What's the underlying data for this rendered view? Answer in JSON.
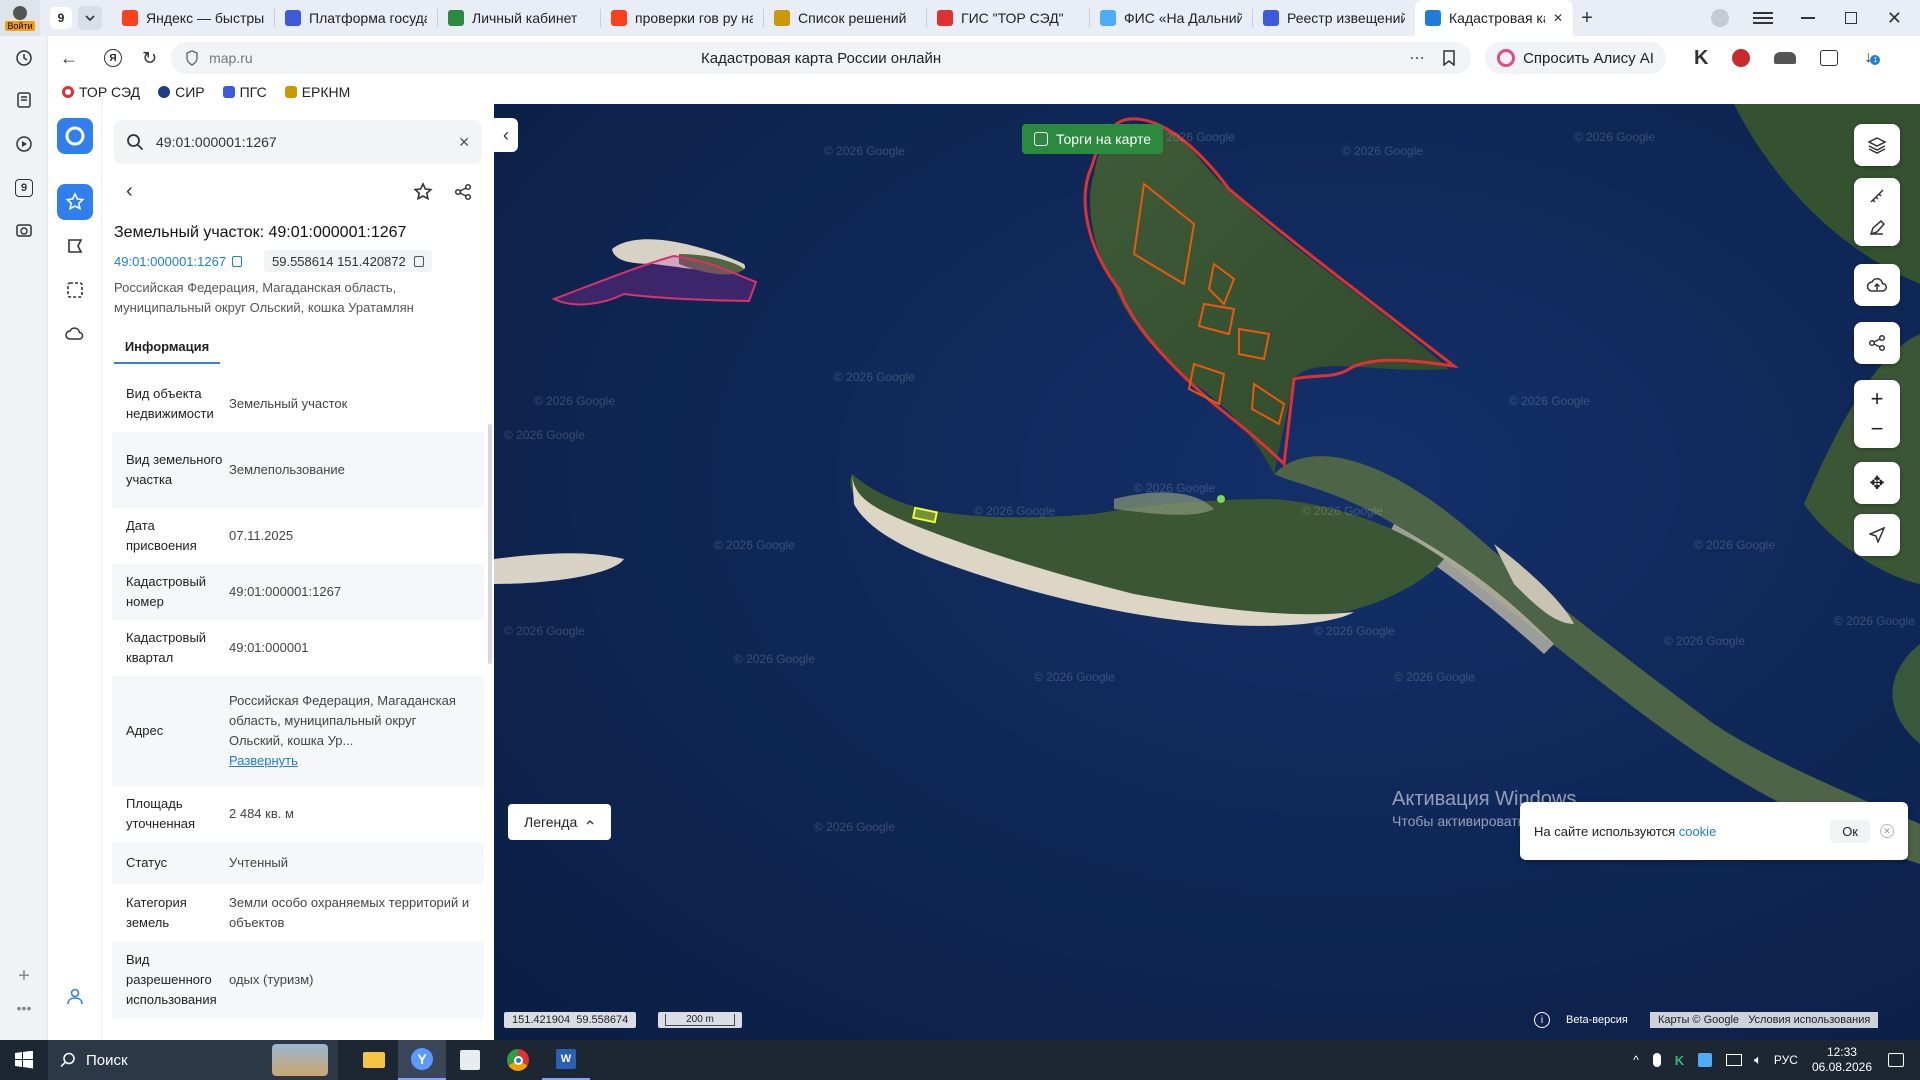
{
  "browser": {
    "profile_label": "Войти",
    "tab_counter": "9",
    "tabs": [
      {
        "title": "Яндекс — быстрый",
        "icon": "yandex-icon",
        "color": "#fc3f1d"
      },
      {
        "title": "Платформа государ",
        "icon": "gov-emblem-icon",
        "color": "#3b5bdb"
      },
      {
        "title": "Личный кабинет",
        "icon": "cabinet-icon",
        "color": "#2b8a3e"
      },
      {
        "title": "проверки гов ру на",
        "icon": "yandex-icon",
        "color": "#fc3f1d"
      },
      {
        "title": "Список решений",
        "icon": "emblem-icon",
        "color": "#c99a06"
      },
      {
        "title": "ГИС \"ТОР СЭД\"",
        "icon": "tor-icon",
        "color": "#e03131"
      },
      {
        "title": "ФИС «На Дальний В",
        "icon": "windows-icon",
        "color": "#4dabf7"
      },
      {
        "title": "Реестр извещений",
        "icon": "gov-emblem-icon",
        "color": "#3b5bdb"
      },
      {
        "title": "Кадастровая кар",
        "icon": "kadastr-icon",
        "color": "#1c7ed6",
        "active": true
      }
    ],
    "address": "map.ru",
    "page_title": "Кадастровая карта России онлайн",
    "alice_label": "Спросить Алису AI",
    "bookmarks": [
      {
        "label": "ТОР СЭД",
        "color": "#e03131"
      },
      {
        "label": "СИР",
        "color": "#1e3a8a"
      },
      {
        "label": "ПГС",
        "color": "#3b5bdb"
      },
      {
        "label": "ЕРКНМ",
        "color": "#c99a06"
      }
    ]
  },
  "sidebar_left": {
    "counter_badge": "9"
  },
  "panel": {
    "search_value": "49:01:000001:1267",
    "title": "Земельный участок: 49:01:000001:1267",
    "cad_link": "49:01:000001:1267",
    "coords": "59.558614 151.420872",
    "address_line": "Российская Федерация, Магаданская область, муниципальный округ Ольский, кошка Уратамлян",
    "tab_label": "Информация",
    "rows": [
      {
        "key": "Вид объекта недвижимости",
        "value": "Земельный участок"
      },
      {
        "key": "Вид земельного участка",
        "value": "Землепользование"
      },
      {
        "key": "Дата присвоения",
        "value": "07.11.2025"
      },
      {
        "key": "Кадастровый номер",
        "value": "49:01:000001:1267"
      },
      {
        "key": "Кадастровый квартал",
        "value": "49:01:000001"
      },
      {
        "key": "Адрес",
        "value": "Российская Федерация, Магаданская область, муниципальный округ Ольский, кошка Ур...",
        "link": "Развернуть"
      },
      {
        "key": "Площадь уточненная",
        "value": "2 484 кв. м"
      },
      {
        "key": "Статус",
        "value": "Учтенный"
      },
      {
        "key": "Категория земель",
        "value": "Земли особо охраняемых территорий и объектов"
      },
      {
        "key": "Вид разрешенного использования",
        "value": "одых (туризм)"
      }
    ]
  },
  "map": {
    "torgi_label": "Торги на карте",
    "legend_label": "Легенда",
    "coords_readout": "151.421904  59.558674",
    "scale_label": "200 m",
    "watermark": "© 2026 Google",
    "beta_label": "Beta-версия",
    "attribution": "Карты © Google   Условия использования",
    "cookie_text_prefix": "На сайте используются ",
    "cookie_link": "cookie",
    "cookie_ok": "Ок",
    "activation_title": "Активация Windows",
    "activation_sub": "Чтобы активировать Windows, перейдите в раздел \"Параметры\"."
  },
  "taskbar": {
    "search_label": "Поиск",
    "lang": "РУС",
    "time": "12:33",
    "date": "06.08.2026"
  }
}
